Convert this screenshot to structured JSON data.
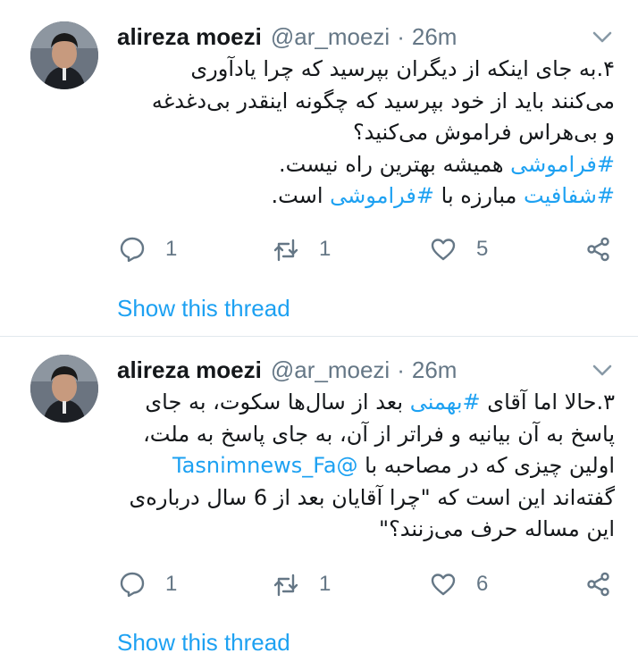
{
  "tweets": [
    {
      "author": {
        "name": "alireza moezi",
        "handle": "@ar_moezi",
        "separator": "·",
        "time": "26m"
      },
      "lines": [
        [
          {
            "t": "۴.به جای اینکه از دیگران بپرسید که چرا یادآوری"
          }
        ],
        [
          {
            "t": "می‌کنند باید از خود بپرسید که چگونه اینقدر بی‌دغدغه"
          }
        ],
        [
          {
            "t": "و بی‌هراس فراموش می‌کنید؟"
          }
        ],
        [
          {
            "t": "#فراموشی",
            "h": true
          },
          {
            "t": " همیشه بهترین راه نیست."
          }
        ],
        [
          {
            "t": "#شفافیت",
            "h": true
          },
          {
            "t": " مبارزه با "
          },
          {
            "t": "#فراموشی",
            "h": true
          },
          {
            "t": " است."
          }
        ]
      ],
      "actions": {
        "reply": "1",
        "retweet": "1",
        "like": "5"
      },
      "show_thread": "Show this thread"
    },
    {
      "author": {
        "name": "alireza moezi",
        "handle": "@ar_moezi",
        "separator": "·",
        "time": "26m"
      },
      "lines": [
        [
          {
            "t": "۳.حالا اما آقای "
          },
          {
            "t": "#بهمنی",
            "h": true
          },
          {
            "t": " بعد از سال‌ها سکوت، به جای"
          }
        ],
        [
          {
            "t": "پاسخ به آن بیانیه و فراتر از آن، به جای پاسخ به ملت،"
          }
        ],
        [
          {
            "t": "اولین چیزی که در مصاحبه با "
          },
          {
            "t": "@Tasnimnews_Fa",
            "h": true
          }
        ],
        [
          {
            "t": "گفته‌اند این است که \"چرا آقایان بعد از 6 سال درباره‌ی"
          }
        ],
        [
          {
            "t": "این مساله حرف می‌زنند؟\""
          }
        ]
      ],
      "actions": {
        "reply": "1",
        "retweet": "1",
        "like": "6"
      },
      "show_thread": "Show this thread"
    }
  ],
  "colors": {
    "link": "#1da1f2",
    "muted": "#657786",
    "text": "#14171a",
    "divider": "#e1e8ed"
  },
  "icons": [
    "caret-down-icon",
    "reply-icon",
    "retweet-icon",
    "like-icon",
    "share-icon"
  ]
}
